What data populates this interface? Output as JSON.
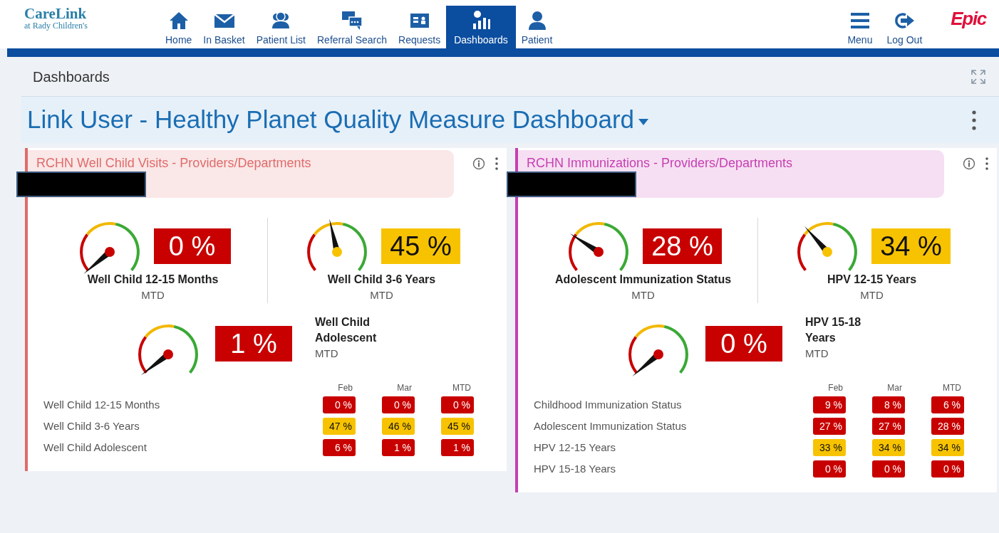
{
  "logo": {
    "name": "CareLink",
    "subtitle": "at Rady Children's"
  },
  "nav": [
    {
      "label": "Home",
      "selected": false
    },
    {
      "label": "In Basket",
      "selected": false
    },
    {
      "label": "Patient List",
      "selected": false
    },
    {
      "label": "Referral Search",
      "selected": false
    },
    {
      "label": "Requests",
      "selected": false
    },
    {
      "label": "Dashboards",
      "selected": true
    },
    {
      "label": "Patient",
      "selected": false
    }
  ],
  "right_nav": [
    {
      "label": "Menu"
    },
    {
      "label": "Log Out"
    }
  ],
  "brand": "Epic",
  "page_title": "Dashboards",
  "dashboard_title": "Link User - Healthy Planet Quality Measure Dashboard",
  "panels": [
    {
      "title": "RCHN Well Child Visits - Providers/Departments",
      "color": "#e06b6b",
      "measures": [
        {
          "name": "Well Child 12-15 Months",
          "period": "MTD",
          "value": "0 %",
          "color": "#c80000",
          "kind": "stacked"
        },
        {
          "name": "Well Child 3-6 Years",
          "period": "MTD",
          "value": "45 %",
          "color": "#f7c300",
          "kind": "stacked"
        },
        {
          "name": "Well Child Adolescent",
          "period": "MTD",
          "value": "1 %",
          "color": "#c80000",
          "kind": "side"
        }
      ],
      "table": {
        "columns": [
          "Feb",
          "Mar",
          "MTD"
        ],
        "rows": [
          {
            "label": "Well Child 12-15 Months",
            "cells": [
              {
                "value": "0 %",
                "color": "#c80000"
              },
              {
                "value": "0 %",
                "color": "#c80000"
              },
              {
                "value": "0 %",
                "color": "#c80000"
              }
            ]
          },
          {
            "label": "Well Child 3-6 Years",
            "cells": [
              {
                "value": "47 %",
                "color": "#f7c300"
              },
              {
                "value": "46 %",
                "color": "#f7c300"
              },
              {
                "value": "45 %",
                "color": "#f7c300"
              }
            ]
          },
          {
            "label": "Well Child Adolescent",
            "cells": [
              {
                "value": "6 %",
                "color": "#c80000"
              },
              {
                "value": "1 %",
                "color": "#c80000"
              },
              {
                "value": "1 %",
                "color": "#c80000"
              }
            ]
          }
        ]
      }
    },
    {
      "title": "RCHN Immunizations - Providers/Departments",
      "color": "#c63fb2",
      "measures": [
        {
          "name": "Adolescent Immunization Status",
          "period": "MTD",
          "value": "28 %",
          "color": "#c80000",
          "kind": "stacked"
        },
        {
          "name": "HPV 12-15 Years",
          "period": "MTD",
          "value": "34 %",
          "color": "#f7c300",
          "kind": "stacked"
        },
        {
          "name": "HPV 15-18 Years",
          "period": "MTD",
          "value": "0 %",
          "color": "#c80000",
          "kind": "side"
        }
      ],
      "table": {
        "columns": [
          "Feb",
          "Mar",
          "MTD"
        ],
        "rows": [
          {
            "label": "Childhood Immunization Status",
            "cells": [
              {
                "value": "9 %",
                "color": "#c80000"
              },
              {
                "value": "8 %",
                "color": "#c80000"
              },
              {
                "value": "6 %",
                "color": "#c80000"
              }
            ]
          },
          {
            "label": "Adolescent Immunization Status",
            "cells": [
              {
                "value": "27 %",
                "color": "#c80000"
              },
              {
                "value": "27 %",
                "color": "#c80000"
              },
              {
                "value": "28 %",
                "color": "#c80000"
              }
            ]
          },
          {
            "label": "HPV 12-15 Years",
            "cells": [
              {
                "value": "33 %",
                "color": "#f7c300"
              },
              {
                "value": "34 %",
                "color": "#f7c300"
              },
              {
                "value": "34 %",
                "color": "#f7c300"
              }
            ]
          },
          {
            "label": "HPV 15-18 Years",
            "cells": [
              {
                "value": "0 %",
                "color": "#c80000"
              },
              {
                "value": "0 %",
                "color": "#c80000"
              },
              {
                "value": "0 %",
                "color": "#c80000"
              }
            ]
          }
        ]
      }
    }
  ]
}
